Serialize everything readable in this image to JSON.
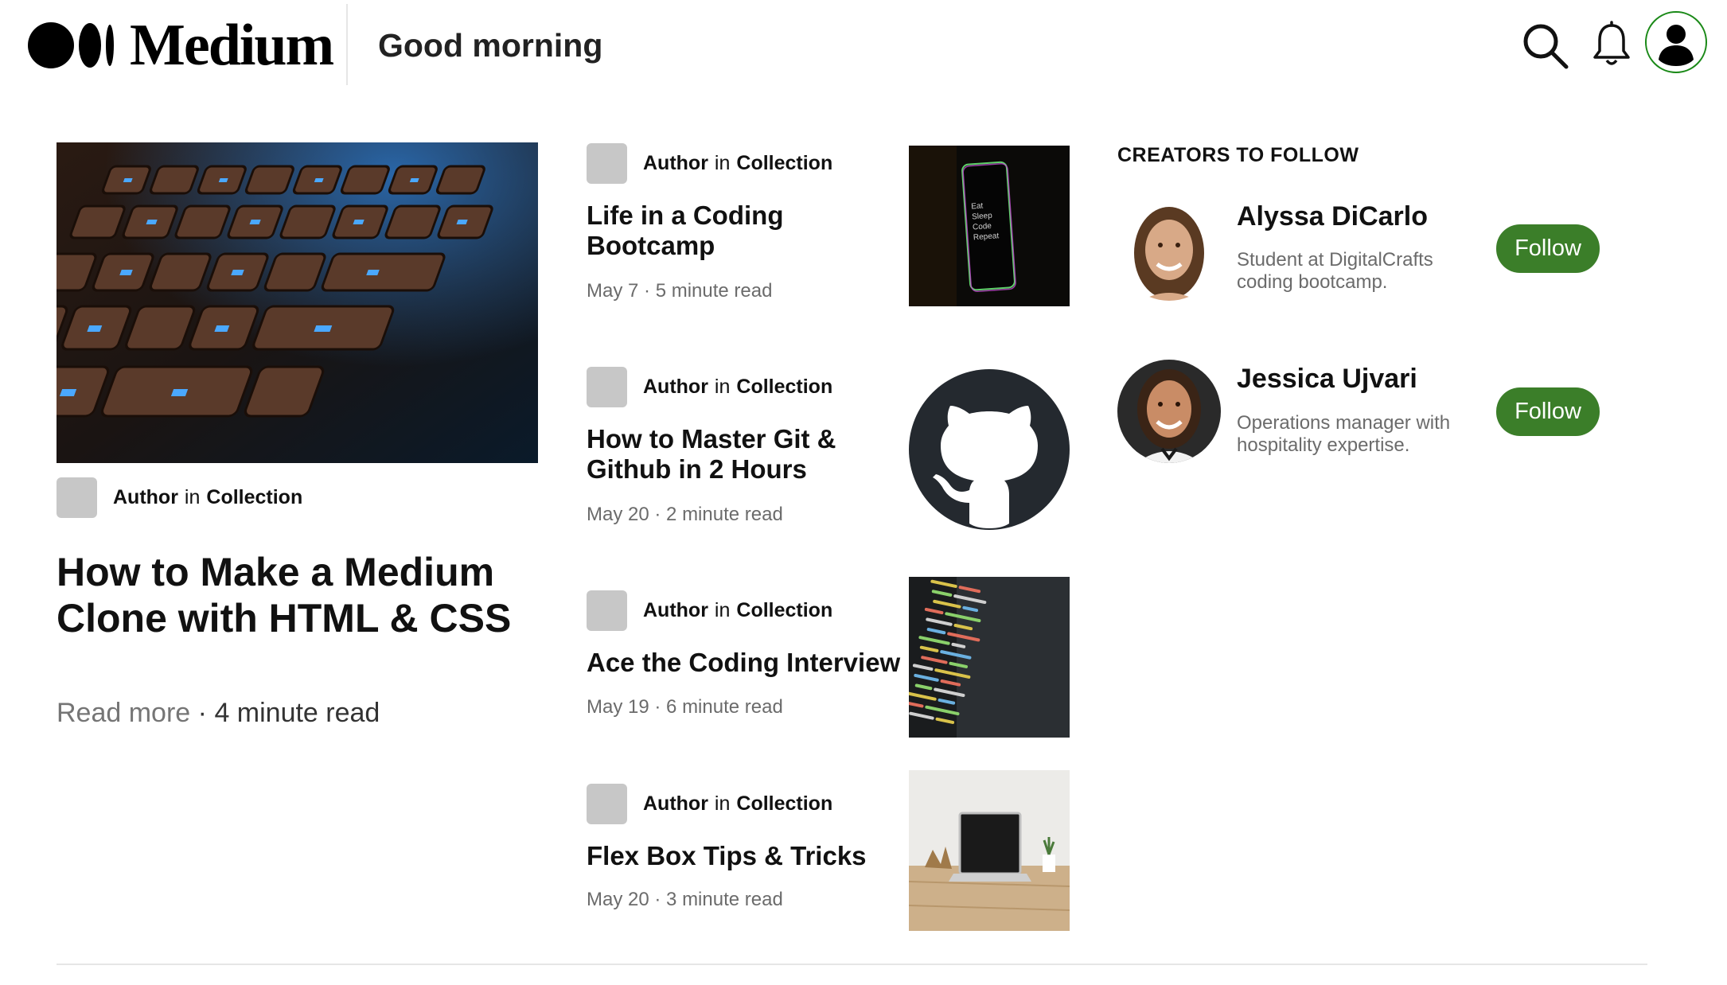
{
  "header": {
    "logo_text": "Medium",
    "greeting": "Good morning",
    "icons": [
      "search-icon",
      "bell-icon",
      "user-avatar-icon"
    ],
    "accent_color": "#1a8917"
  },
  "featured": {
    "author": "Author",
    "in": "in",
    "collection": "Collection",
    "title": "How to Make a Medium Clone with HTML & CSS",
    "read_more": "Read more",
    "separator": "·",
    "read_time": "4 minute read"
  },
  "articles": [
    {
      "author": "Author",
      "in": "in",
      "collection": "Collection",
      "title": "Life in a Coding Bootcamp",
      "date": "May 7",
      "sep": "·",
      "read_time": "5 minute read",
      "thumb": "eat-sleep-code-repeat-phone"
    },
    {
      "author": "Author",
      "in": "in",
      "collection": "Collection",
      "title": "How to Master Git & Github in 2 Hours",
      "date": "May 20",
      "sep": "·",
      "read_time": "2 minute read",
      "thumb": "github-logo"
    },
    {
      "author": "Author",
      "in": "in",
      "collection": "Collection",
      "title": "Ace the Coding Interview",
      "date": "May 19",
      "sep": "·",
      "read_time": "6 minute read",
      "thumb": "code-screen"
    },
    {
      "author": "Author",
      "in": "in",
      "collection": "Collection",
      "title": "Flex Box Tips & Tricks",
      "date": "May 20",
      "sep": "·",
      "read_time": "3 minute read",
      "thumb": "laptop-desk"
    }
  ],
  "creators": {
    "heading": "CREATORS TO FOLLOW",
    "people": [
      {
        "name": "Alyssa DiCarlo",
        "bio": "Student at DigitalCrafts coding bootcamp.",
        "follow": "Follow"
      },
      {
        "name": "Jessica Ujvari",
        "bio": "Operations manager with hospitality expertise.",
        "follow": "Follow"
      }
    ],
    "follow_color": "#3b7e29"
  },
  "thumb_text": {
    "phone_lines": [
      "Eat",
      "Sleep",
      "Code",
      "Repeat"
    ]
  }
}
